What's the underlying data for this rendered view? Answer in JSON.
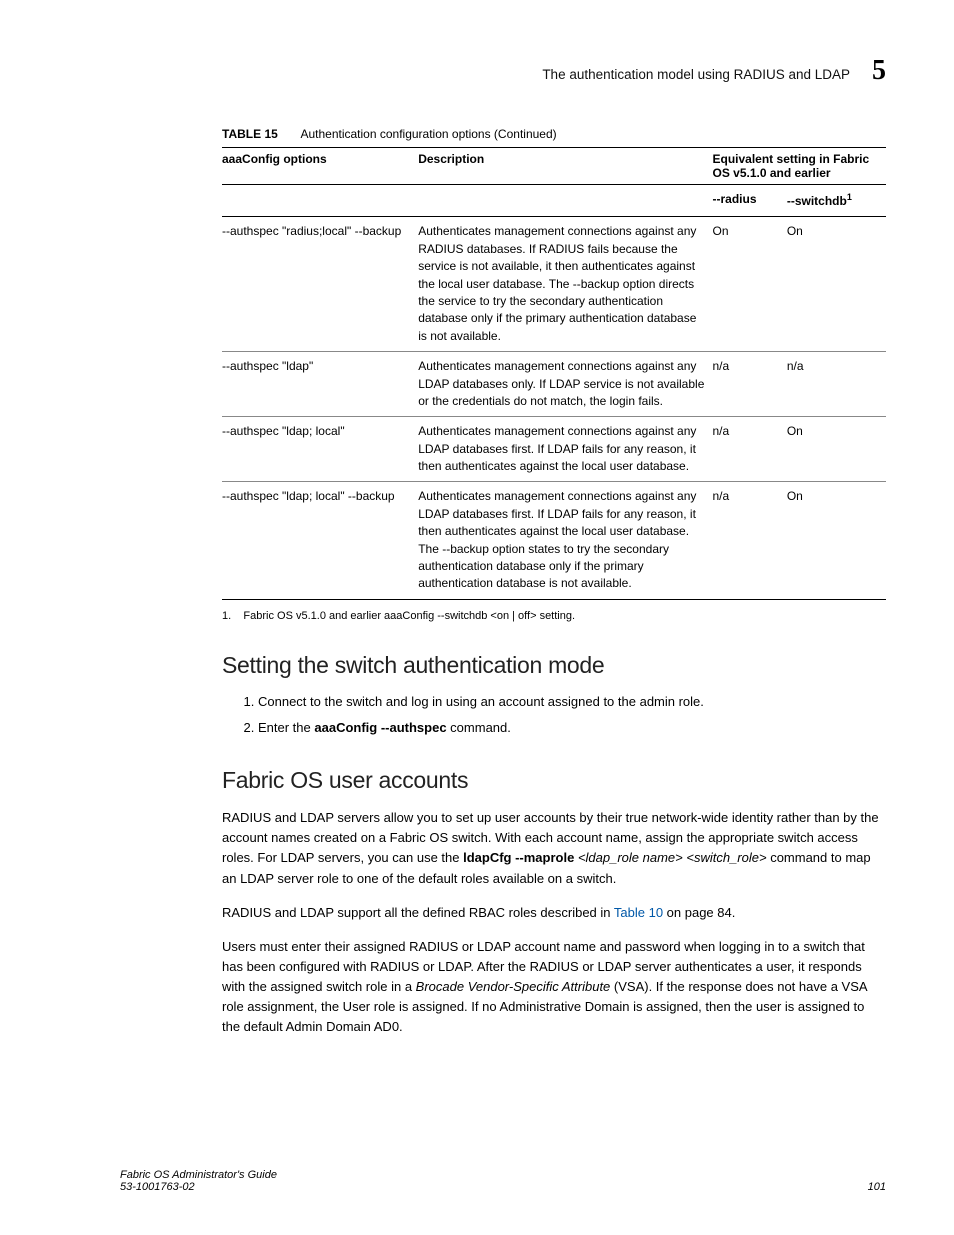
{
  "header": {
    "title": "The authentication model using RADIUS and LDAP",
    "chapter_number": "5"
  },
  "table": {
    "label": "TABLE 15",
    "caption": "Authentication configuration options (Continued)",
    "head": {
      "col1": "aaaConfig options",
      "col2": "Description",
      "col34": "Equivalent setting in Fabric OS v5.1.0 and earlier",
      "sub3": "--radius",
      "sub4_prefix": "--switchdb",
      "sub4_sup": "1"
    },
    "rows": [
      {
        "opt": "--authspec \"radius;local\" --backup",
        "desc": "Authenticates management connections against any RADIUS databases. If RADIUS fails because the service is not available, it then authenticates against the local user database. The --backup option directs the service to try the secondary authentication database only if the primary authentication database is not available.",
        "radius": "On",
        "switchdb": "On"
      },
      {
        "opt": "--authspec \"ldap\"",
        "desc": "Authenticates management connections against any LDAP databases only. If LDAP service is not available or the credentials do not match, the login fails.",
        "radius": "n/a",
        "switchdb": "n/a"
      },
      {
        "opt": "--authspec \"ldap; local\"",
        "desc": "Authenticates management connections against any LDAP databases first. If LDAP fails for any reason, it then authenticates against the local user database.",
        "radius": "n/a",
        "switchdb": "On"
      },
      {
        "opt": "--authspec \"ldap; local\" --backup",
        "desc": "Authenticates management connections against any LDAP databases first. If LDAP fails for any reason, it then authenticates against the local user database. The --backup option states to try the secondary authentication database only if the primary authentication database is not available.",
        "radius": "n/a",
        "switchdb": "On"
      }
    ],
    "footnote_num": "1.",
    "footnote": "Fabric OS v5.1.0 and earlier aaaConfig --switchdb <on | off> setting."
  },
  "section1": {
    "heading": "Setting the switch authentication mode",
    "steps": {
      "s1": "Connect to the switch and log in using an account assigned to the admin role.",
      "s2_pre": "Enter the ",
      "s2_cmd": "aaaConfig --authspec",
      "s2_post": "  command."
    }
  },
  "section2": {
    "heading": "Fabric OS user accounts",
    "p1_a": "RADIUS and LDAP servers allow you to set up user accounts by their true network-wide identity rather than by the account names created on a Fabric OS switch. With each account name, assign the appropriate switch access roles. For LDAP servers, you can use the ",
    "p1_cmd": "ldapCfg --maprole",
    "p1_b_italic": "<ldap_role name> <switch_role>",
    "p1_c": " command to map an LDAP server role to one of the default roles available on a switch.",
    "p2_a": "RADIUS and LDAP support all the defined RBAC roles described in ",
    "p2_link": "Table 10",
    "p2_b": " on page 84.",
    "p3_a": "Users must enter their assigned RADIUS or LDAP account name and password when logging in to a switch that has been configured with RADIUS or LDAP. After the RADIUS or LDAP server authenticates a user, it responds with the assigned switch role in a ",
    "p3_italic": "Brocade Vendor-Specific Attribute",
    "p3_b": " (VSA). If the response does not have a VSA role assignment, the User role is assigned. If no Administrative Domain is assigned, then the user is assigned to the default Admin Domain AD0."
  },
  "footer": {
    "guide": "Fabric OS Administrator's Guide",
    "docnum": "53-1001763-02",
    "page": "101"
  }
}
